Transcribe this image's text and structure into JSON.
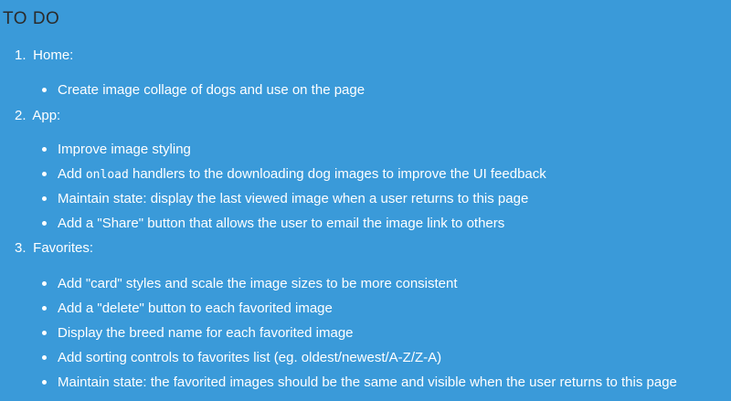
{
  "page": {
    "title": "TO DO"
  },
  "sections": [
    {
      "number": "1.",
      "label": "Home:",
      "items": [
        {
          "text": "Create image collage of dogs and use on the page"
        }
      ]
    },
    {
      "number": "2.",
      "label": "App:",
      "items": [
        {
          "text": "Improve image styling"
        },
        {
          "before": "Add ",
          "code": "onload",
          "after": " handlers to the downloading dog images to improve the UI feedback"
        },
        {
          "text": "Maintain state: display the last viewed image when a user returns to this page"
        },
        {
          "text": "Add a \"Share\" button that allows the user to email the image link to others"
        }
      ]
    },
    {
      "number": "3.",
      "label": "Favorites:",
      "items": [
        {
          "text": "Add \"card\" styles and scale the image sizes to be more consistent"
        },
        {
          "text": "Add a \"delete\" button to each favorited image"
        },
        {
          "text": "Display the breed name for each favorited image"
        },
        {
          "text": "Add sorting controls to favorites list (eg. oldest/newest/A-Z/Z-A)"
        },
        {
          "text": "Maintain state: the favorited images should be the same and visible when the user returns to this page"
        }
      ]
    }
  ]
}
